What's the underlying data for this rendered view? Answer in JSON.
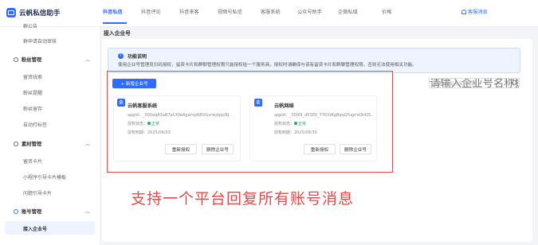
{
  "app": {
    "name": "云帆私信助手"
  },
  "nav": {
    "tabs": [
      "抖音私信",
      "抖音评论",
      "抖音来客",
      "视频号私信",
      "客服系统",
      "公众号助手",
      "企微私域",
      "价格"
    ],
    "support": "客服消息"
  },
  "sidebar": {
    "partial_top": "群公告",
    "auto_move": "群申请自动审核",
    "groups": [
      {
        "label": "粉丝管理",
        "items": [
          "留资线索",
          "粉丝提醒",
          "粉丝留存",
          "自动打标签"
        ]
      },
      {
        "label": "素材管理",
        "items": [
          "留资卡片",
          "小程序引导卡片模板",
          "问题引导卡片"
        ]
      },
      {
        "label": "账号管理",
        "items": [
          "接入企业号"
        ]
      }
    ],
    "active": "接入企业号"
  },
  "page": {
    "title": "接入企业号"
  },
  "notice": {
    "title": "功能说明",
    "body": "使用企业号管理员扫码授权，留资卡片和群聊管理权限只能授权给一个服务商，授权时请确保与该有留资卡片和群聊管理权限，否则无法使用相关功能。"
  },
  "toolbar": {
    "add_label": "+ 新增企业号",
    "search_placeholder": "请输入企业号名称搜索"
  },
  "cards": [
    {
      "name": "云帆客服系统",
      "appid": "appid：_000aqA3aB7pCKfw6ganrpN8VGvrwjiqqcBJ...",
      "auth_label": "授权状态：",
      "status": "正常",
      "expire": "授权到期：2025/06/03",
      "reauth": "重新授权",
      "delete": "删除企业号"
    },
    {
      "name": "云帆网络",
      "appid": "appid：_000l9_d530V_Y7KIOKg8qqGYugmd3rKI5...",
      "auth_label": "授权状态：",
      "status": "正常",
      "expire": "授权到期：2025/06/30",
      "reauth": "重新授权",
      "delete": "删除企业号"
    }
  ],
  "annotation": {
    "caption": "支持一个平台回复所有账号消息"
  },
  "colors": {
    "accent": "#2f6bff",
    "highlight": "#e34a4a",
    "ok": "#19b26b"
  }
}
